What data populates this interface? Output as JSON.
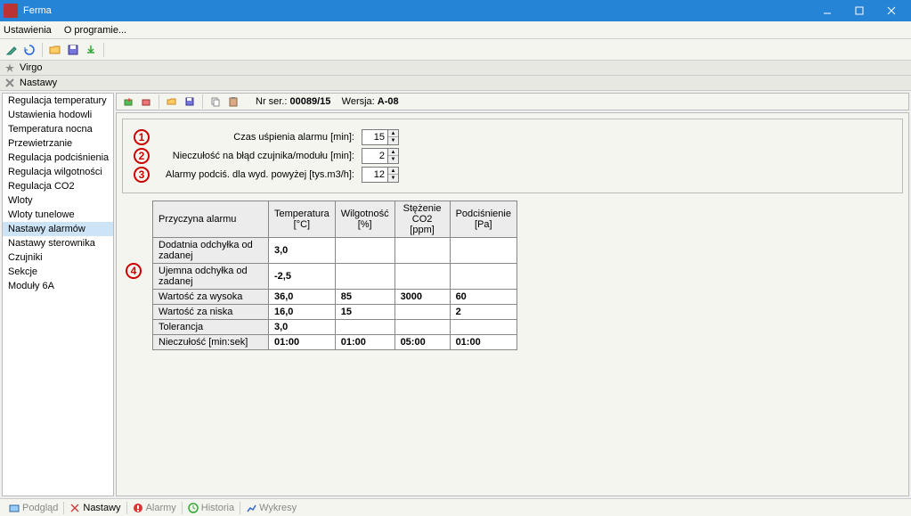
{
  "window": {
    "title": "Ferma"
  },
  "menu": {
    "settings": "Ustawienia",
    "about": "O programie..."
  },
  "panels": {
    "virgo": "Virgo",
    "nastawy": "Nastawy"
  },
  "sidebar": {
    "items": [
      "Regulacja temperatury",
      "Ustawienia hodowli",
      "Temperatura nocna",
      "Przewietrzanie",
      "Regulacja podciśnienia",
      "Regulacja wilgotności",
      "Regulacja CO2",
      "Wloty",
      "Wloty tunelowe",
      "Nastawy alarmów",
      "Nastawy sterownika",
      "Czujniki",
      "Sekcje",
      "Moduły 6A"
    ],
    "active_index": 9
  },
  "device": {
    "serial_label": "Nr ser.:",
    "serial": "00089/15",
    "version_label": "Wersja:",
    "version": "A-08"
  },
  "fields": {
    "sleep": {
      "label": "Czas uśpienia alarmu [min]:",
      "value": "15"
    },
    "insens": {
      "label": "Nieczułość na błąd czujnika/modułu [min]:",
      "value": "2"
    },
    "vacuum": {
      "label": "Alarmy podciś. dla wyd. powyżej [tys.m3/h]:",
      "value": "12"
    }
  },
  "table": {
    "headers": [
      "Przyczyna alarmu",
      "Temperatura [°C]",
      "Wilgotność [%]",
      "Stężenie CO2 [ppm]",
      "Podciśnienie [Pa]"
    ],
    "rows": [
      {
        "label": "Dodatnia odchyłka od zadanej",
        "cells": [
          "3,0",
          "",
          "",
          ""
        ]
      },
      {
        "label": "Ujemna odchyłka od zadanej",
        "cells": [
          "-2,5",
          "",
          "",
          ""
        ]
      },
      {
        "label": "Wartość za wysoka",
        "cells": [
          "36,0",
          "85",
          "3000",
          "60"
        ]
      },
      {
        "label": "Wartość za niska",
        "cells": [
          "16,0",
          "15",
          "",
          "2"
        ]
      },
      {
        "label": "Tolerancja",
        "cells": [
          "3,0",
          "",
          "",
          ""
        ]
      },
      {
        "label": "Nieczułość [min:sek]",
        "cells": [
          "01:00",
          "01:00",
          "05:00",
          "01:00"
        ]
      }
    ]
  },
  "statusbar": {
    "podglad": "Podgląd",
    "nastawy": "Nastawy",
    "alarmy": "Alarmy",
    "historia": "Historia",
    "wykresy": "Wykresy"
  },
  "badges": {
    "b1": "1",
    "b2": "2",
    "b3": "3",
    "b4": "4"
  }
}
